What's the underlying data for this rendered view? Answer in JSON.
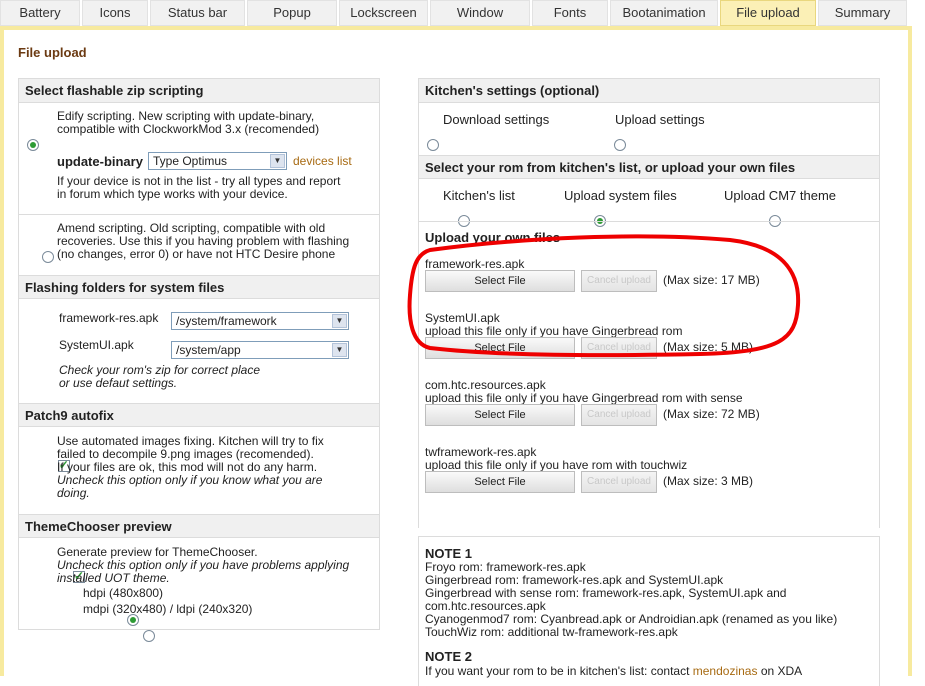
{
  "tabs": [
    "Battery",
    "Icons",
    "Status bar",
    "Popup",
    "Lockscreen",
    "Window",
    "Fonts",
    "Bootanimation",
    "File upload",
    "Summary"
  ],
  "page_title": "File upload",
  "left": {
    "zip": {
      "heading": "Select flashable zip scripting",
      "edify_l1": "Edify scripting. New scripting with update-binary,",
      "edify_l2": "compatible with ClockworkMod 3.x (recomended)",
      "ub_label": "update-binary",
      "ub_value": "Type Optimus",
      "devices_link": "devices list",
      "note_l1": "If your device is not in the list - try all types and report",
      "note_l2": "in forum which type works with your device.",
      "amend_l1": "Amend scripting. Old scripting, compatible with old",
      "amend_l2": "recoveries. Use this if you having problem with flashing",
      "amend_l3": "(no changes, error 0) or have not HTC Desire phone"
    },
    "folders": {
      "heading": "Flashing folders for system files",
      "fw_label": "framework-res.apk",
      "fw_value": "/system/framework",
      "sui_label": "SystemUI.apk",
      "sui_value": "/system/app",
      "hint_l1": "Check your rom's zip for correct place",
      "hint_l2": "or use defaut settings."
    },
    "patch9": {
      "heading": "Patch9 autofix",
      "l1": "Use automated images fixing. Kitchen will try to fix",
      "l2": "failed to decompile 9.png images (recomended).",
      "l3": "If your files are ok, this mod will not do any harm.",
      "l4": "Uncheck this option only if you know what you are",
      "l5": "doing."
    },
    "theme": {
      "heading": "ThemeChooser preview",
      "l1": "Generate preview for ThemeChooser.",
      "l2": "Uncheck this option only if you have problems applying",
      "l3": "installed UOT theme.",
      "hdpi": "hdpi (480x800)",
      "mdpi": "mdpi (320x480) / ldpi (240x320)"
    }
  },
  "right": {
    "kitchen": {
      "heading": "Kitchen's settings (optional)",
      "download": "Download settings",
      "upload": "Upload settings"
    },
    "rom": {
      "heading": "Select your rom from kitchen's list, or upload your own files",
      "opt1": "Kitchen's list",
      "opt2": "Upload system files",
      "opt3": "Upload CM7 theme"
    },
    "own": {
      "heading": "Upload your own files",
      "select_label": "Select File",
      "cancel_label": "Cancel upload",
      "files": [
        {
          "name": "framework-res.apk",
          "note": "",
          "max": "(Max size: 17 MB)"
        },
        {
          "name": "SystemUI.apk",
          "note": "upload this file only if you have Gingerbread rom",
          "max": "(Max size: 5 MB)"
        },
        {
          "name": "com.htc.resources.apk",
          "note": "upload this file only if you have Gingerbread rom with sense",
          "max": "(Max size: 72 MB)"
        },
        {
          "name": "twframework-res.apk",
          "note": "upload this file only if you have rom with touchwiz",
          "max": "(Max size: 3 MB)"
        }
      ]
    },
    "note1": {
      "title": "NOTE 1",
      "lines": [
        "Froyo rom: framework-res.apk",
        "Gingerbread rom: framework-res.apk and SystemUI.apk",
        "Gingerbread with sense rom: framework-res.apk, SystemUI.apk and",
        "com.htc.resources.apk",
        "Cyanogenmod7 rom: Cyanbread.apk or Androidian.apk (renamed as you like)",
        "TouchWiz rom: additional tw-framework-res.apk"
      ]
    },
    "note2": {
      "title": "NOTE 2",
      "line": "If you want your rom to be in kitchen's list: contact",
      "link": "mendozinas",
      "tail": "on XDA"
    }
  },
  "colors": {
    "accent": "#f7ea9f",
    "title": "#6b3a12",
    "radio_on": "#2e9b35",
    "annotation": "#ee0000",
    "link": "#a76a12"
  }
}
